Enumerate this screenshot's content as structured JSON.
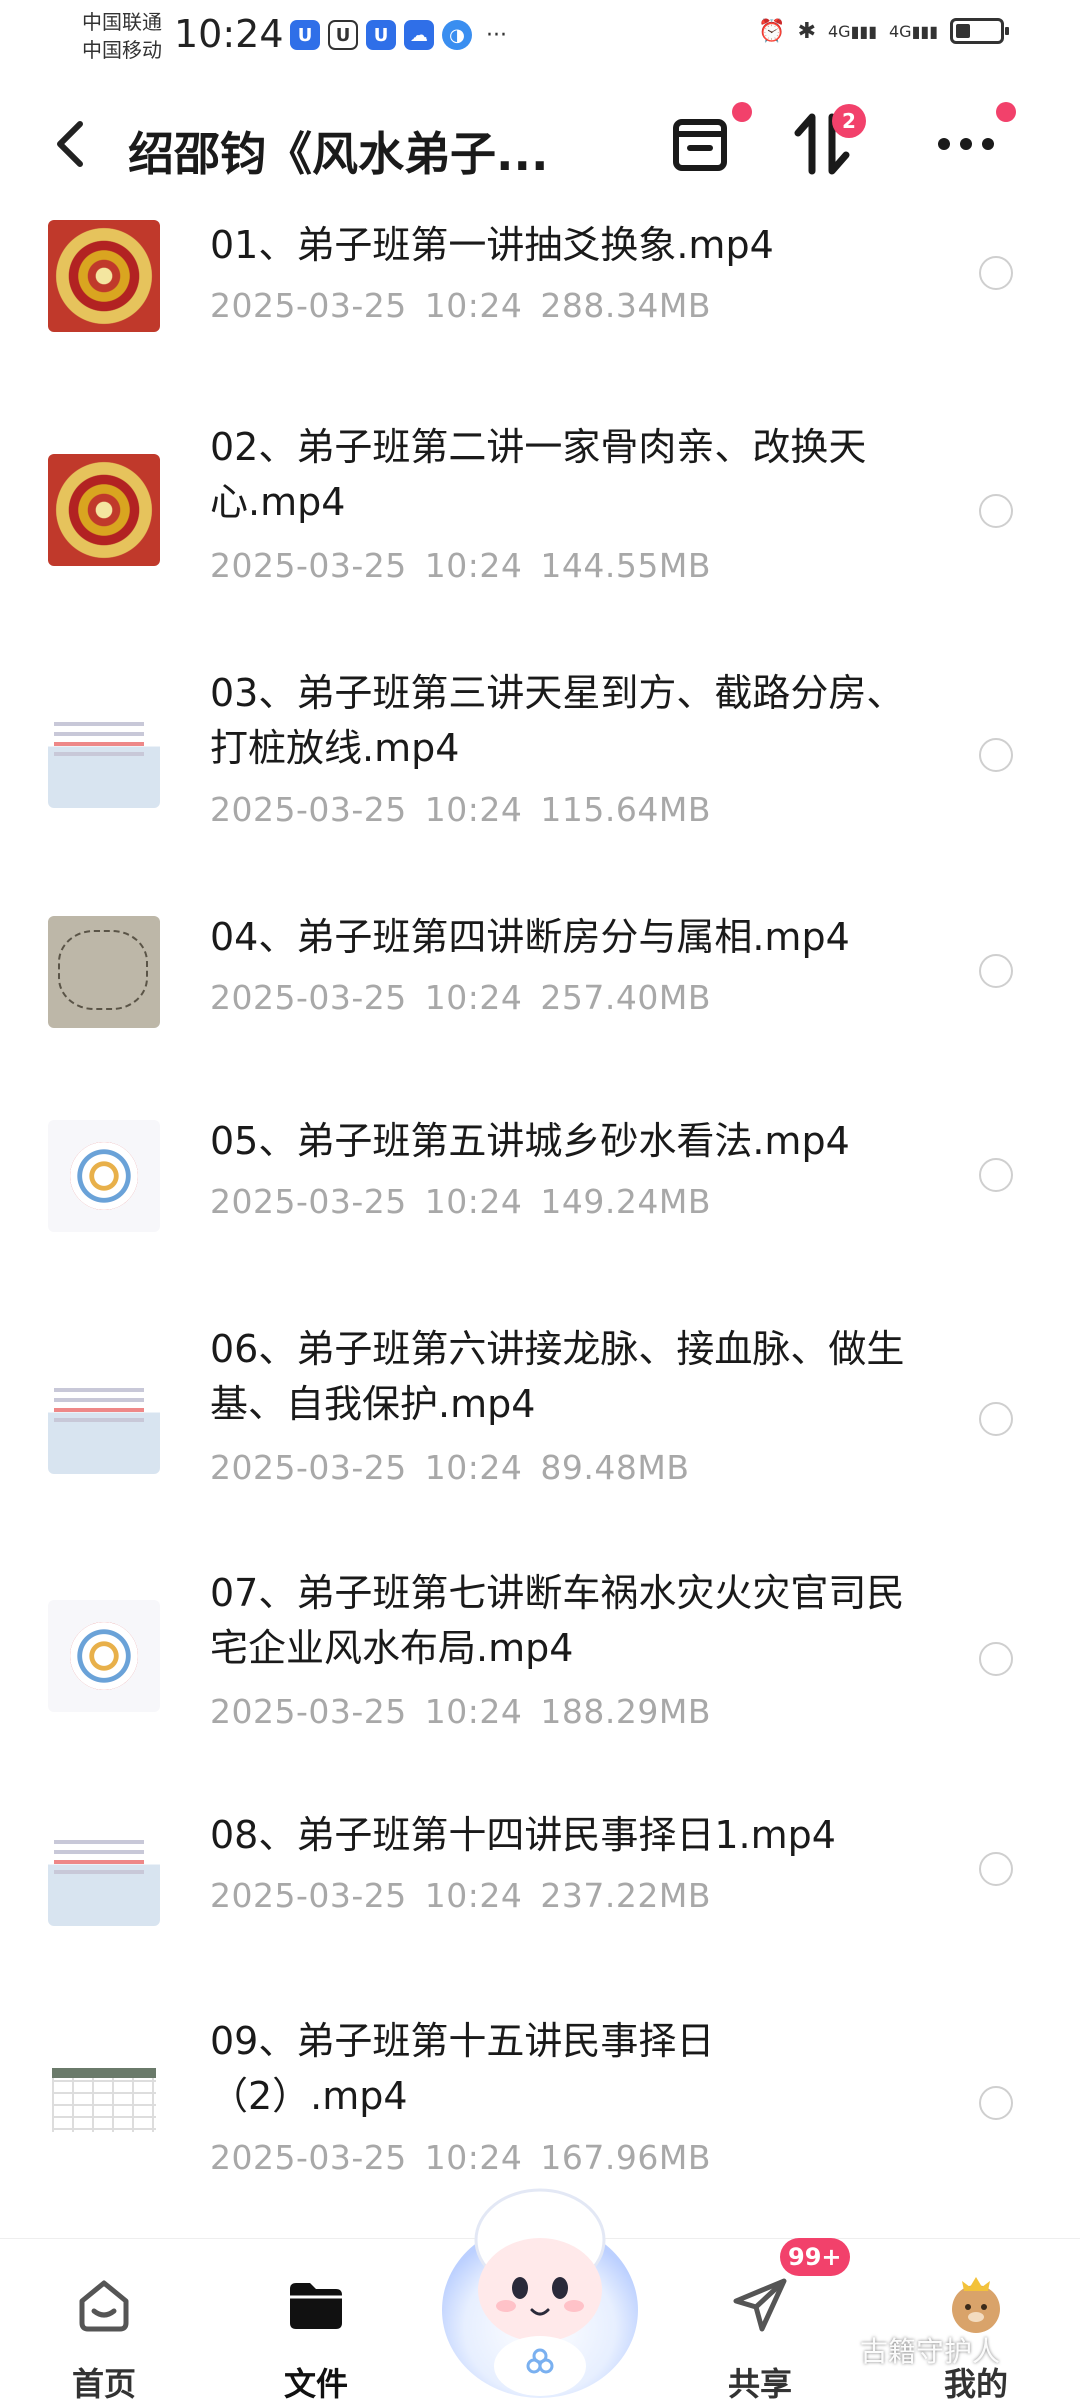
{
  "status_bar": {
    "carrier_1": "中国联通",
    "carrier_2": "中国移动",
    "time": "10:24",
    "network_1": "4G",
    "network_2": "4G",
    "more": "···"
  },
  "header": {
    "title": "绍邵钧《风水弟子...",
    "back_icon": "chevron-left-icon",
    "transfer_badge": "2"
  },
  "files": [
    {
      "name": "01、弟子班第一讲抽爻换象.mp4",
      "date": "2025-03-25",
      "time": "10:24",
      "size": "288.34MB",
      "thumb": "compass"
    },
    {
      "name": "02、弟子班第二讲一家骨肉亲、改换天心.mp4",
      "date": "2025-03-25",
      "time": "10:24",
      "size": "144.55MB",
      "thumb": "compass"
    },
    {
      "name": "03、弟子班第三讲天星到方、截路分房、打桩放线.mp4",
      "date": "2025-03-25",
      "time": "10:24",
      "size": "115.64MB",
      "thumb": "doc"
    },
    {
      "name": "04、弟子班第四讲断房分与属相.mp4",
      "date": "2025-03-25",
      "time": "10:24",
      "size": "257.40MB",
      "thumb": "sketch"
    },
    {
      "name": "05、弟子班第五讲城乡砂水看法.mp4",
      "date": "2025-03-25",
      "time": "10:24",
      "size": "149.24MB",
      "thumb": "wheel"
    },
    {
      "name": "06、弟子班第六讲接龙脉、接血脉、做生基、自我保护.mp4",
      "date": "2025-03-25",
      "time": "10:24",
      "size": "89.48MB",
      "thumb": "doc"
    },
    {
      "name": "07、弟子班第七讲断车祸水灾火灾官司民宅企业风水布局.mp4",
      "date": "2025-03-25",
      "time": "10:24",
      "size": "188.29MB",
      "thumb": "wheel"
    },
    {
      "name": "08、弟子班第十四讲民事择日1.mp4",
      "date": "2025-03-25",
      "time": "10:24",
      "size": "237.22MB",
      "thumb": "doc"
    },
    {
      "name": "09、弟子班第十五讲民事择日（2）.mp4",
      "date": "2025-03-25",
      "time": "10:24",
      "size": "167.96MB",
      "thumb": "table"
    }
  ],
  "bottom_nav": {
    "items": [
      {
        "label": "首页",
        "icon": "home-icon"
      },
      {
        "label": "文件",
        "icon": "folder-icon"
      },
      {
        "label": "共享",
        "icon": "send-icon"
      },
      {
        "label": "我的",
        "icon": "avatar-icon"
      }
    ],
    "share_badge": "99+"
  },
  "watermark": "古籍守护人",
  "colors": {
    "accent_red": "#f2416b",
    "meta_gray": "#a8a8a8"
  }
}
